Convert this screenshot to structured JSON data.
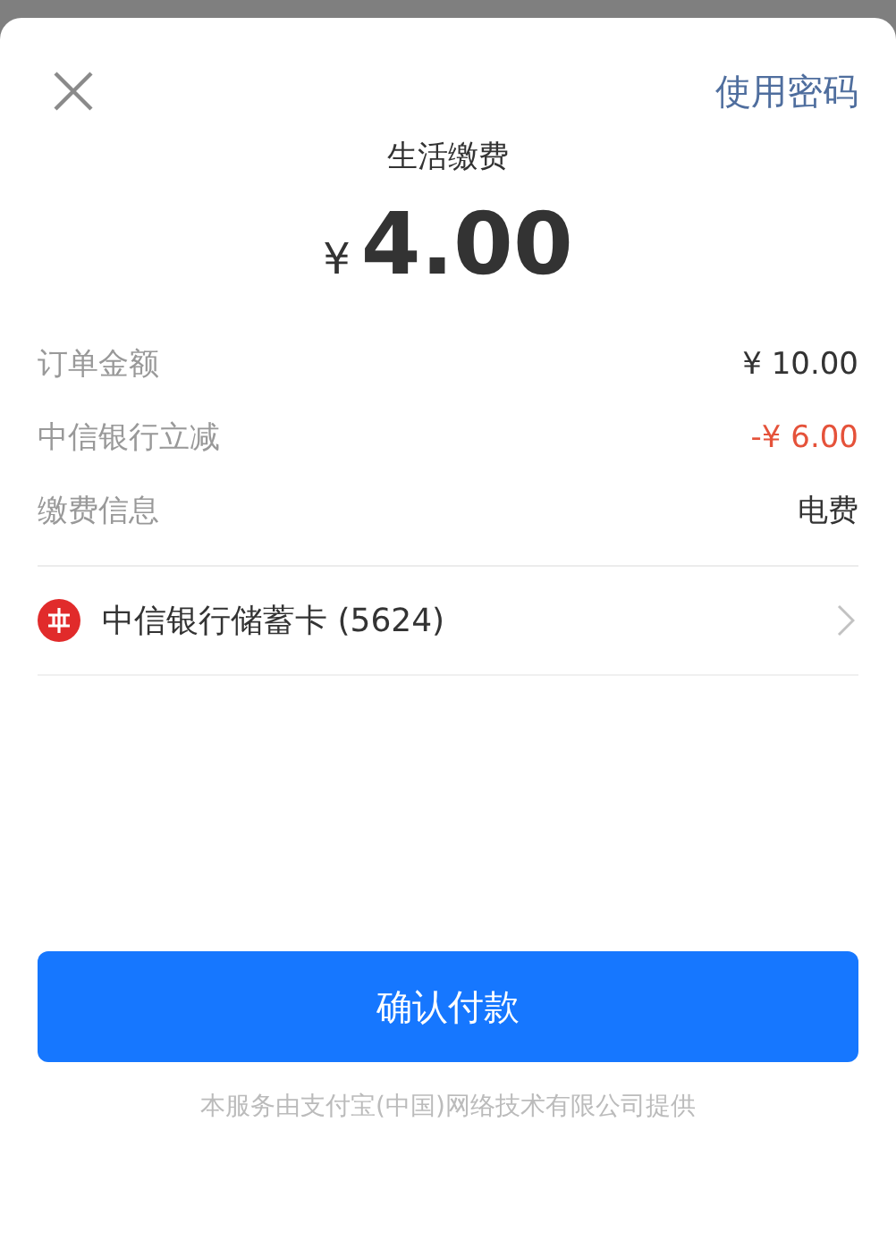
{
  "sheet": {
    "use_password": "使用密码",
    "title": "生活缴费",
    "currency": "¥",
    "amount": "4.00"
  },
  "details": [
    {
      "kind": "plain",
      "label": "订单金额",
      "value": "¥ 10.00"
    },
    {
      "kind": "discount",
      "label": "中信银行立减",
      "value": "-¥ 6.00"
    },
    {
      "kind": "plain",
      "label": "缴费信息",
      "value": "电费"
    }
  ],
  "payment_method": {
    "name": "中信银行储蓄卡 (5624)"
  },
  "confirm_button": "确认付款",
  "footer": "本服务由支付宝(中国)网络技术有限公司提供"
}
